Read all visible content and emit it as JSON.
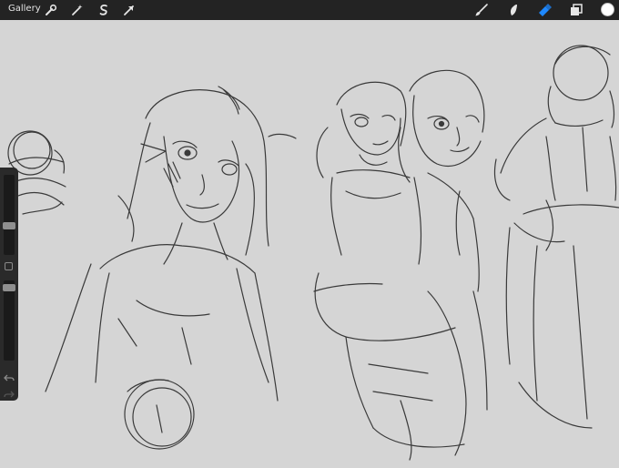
{
  "topbar": {
    "gallery_label": "Gallery",
    "left_tools": [
      {
        "name": "actions",
        "icon": "wrench-icon"
      },
      {
        "name": "adjustments",
        "icon": "magic-wand-icon"
      },
      {
        "name": "selection",
        "icon": "s-selection-icon"
      },
      {
        "name": "transform",
        "icon": "arrow-cursor-icon"
      }
    ],
    "right_tools": [
      {
        "name": "brush",
        "icon": "brush-icon"
      },
      {
        "name": "smudge",
        "icon": "smudge-icon"
      },
      {
        "name": "eraser",
        "icon": "eraser-icon",
        "active": true
      },
      {
        "name": "layers",
        "icon": "layers-icon"
      }
    ],
    "active_color": "#ffffff",
    "active_tool_color": "#1e88ff"
  },
  "sidebar": {
    "brush_size": 0.35,
    "opacity": 0.95,
    "icons": [
      "modify-square-icon",
      "undo-icon",
      "redo-icon"
    ]
  },
  "canvas": {
    "background": "#d5d5d5",
    "stroke_color": "#3a3a3a"
  }
}
